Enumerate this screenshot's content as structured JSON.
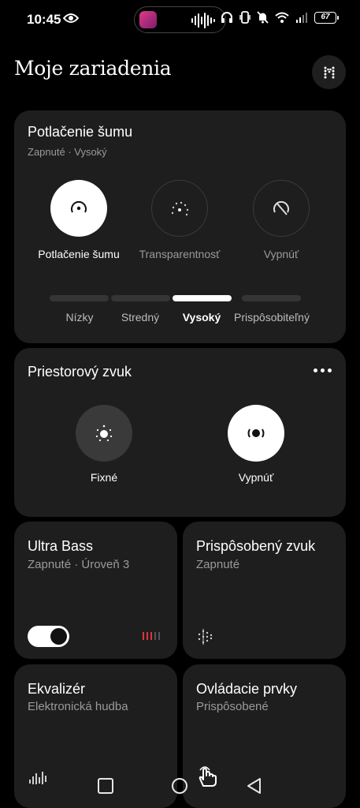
{
  "status_bar": {
    "time": "10:45",
    "battery": "67",
    "icons": [
      "eye-icon",
      "headphones-icon",
      "vibrate-icon",
      "mute-icon",
      "wifi-icon",
      "signal-icon",
      "battery-icon"
    ]
  },
  "header": {
    "title": "Moje zariadenia",
    "menu_icon": "device-menu-icon"
  },
  "noise_control": {
    "title": "Potlačenie šumu",
    "subtitle": "Zapnuté · Vysoký",
    "modes": [
      {
        "label": "Potlačenie šumu",
        "icon": "noise-cancel-icon",
        "active": true
      },
      {
        "label": "Transparentnosť",
        "icon": "transparency-icon",
        "active": false
      },
      {
        "label": "Vypnúť",
        "icon": "off-icon",
        "active": false
      }
    ],
    "levels": [
      {
        "label": "Nízky",
        "active": false
      },
      {
        "label": "Stredný",
        "active": false
      },
      {
        "label": "Vysoký",
        "active": true
      },
      {
        "label": "Prispôsobiteľný",
        "active": false
      }
    ]
  },
  "spatial_audio": {
    "title": "Priestorový zvuk",
    "more_icon": "more-dots-icon",
    "modes": [
      {
        "label": "Fixné",
        "icon": "fixed-spatial-icon",
        "active": false
      },
      {
        "label": "Vypnúť",
        "icon": "spatial-off-icon",
        "active": true
      }
    ]
  },
  "ultra_bass": {
    "title": "Ultra Bass",
    "subtitle": "Zapnuté · Úroveň 3",
    "toggle_on": true,
    "level": 3,
    "level_max": 5
  },
  "personalized_sound": {
    "title": "Prispôsobený zvuk",
    "subtitle": "Zapnuté"
  },
  "equalizer": {
    "title": "Ekvalizér",
    "subtitle": "Elektronická hudba"
  },
  "controls": {
    "title": "Ovládacie prvky",
    "subtitle": "Prispôsobené"
  },
  "colors": {
    "background": "#000000",
    "card": "#1e1e1e",
    "accent_red": "#e0353b",
    "muted_text": "#9a9a9a"
  }
}
